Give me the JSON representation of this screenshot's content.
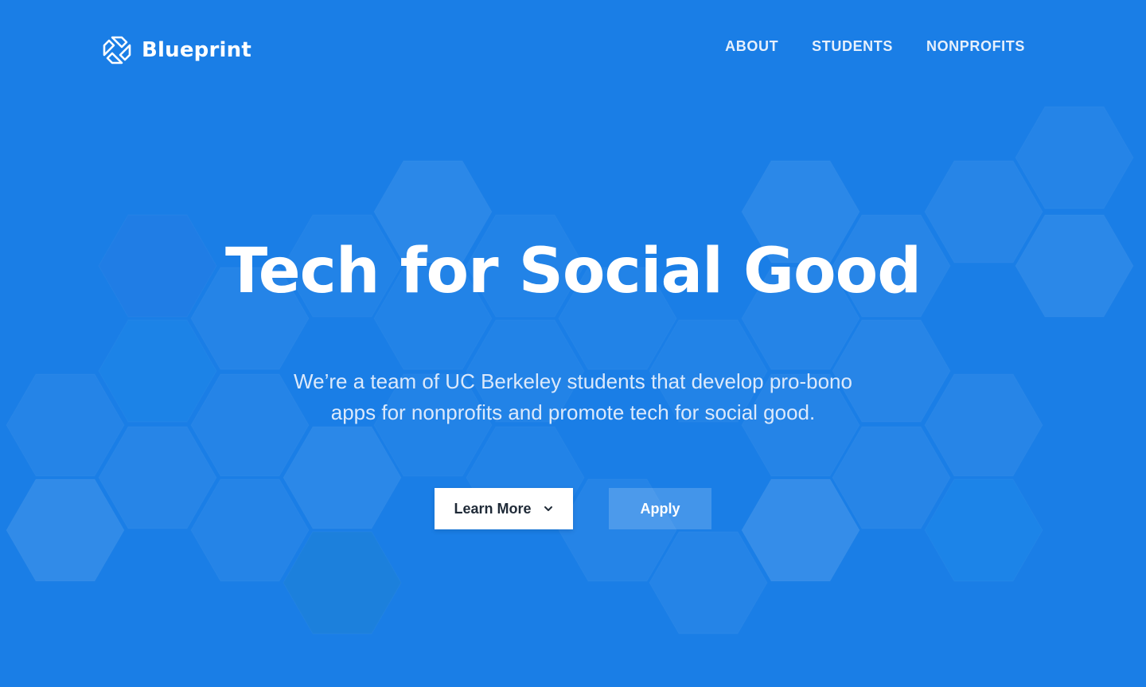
{
  "header": {
    "brand": "Blueprint",
    "nav": [
      {
        "label": "ABOUT"
      },
      {
        "label": "STUDENTS"
      },
      {
        "label": "NONPROFITS"
      }
    ]
  },
  "hero": {
    "title": "Tech for Social Good",
    "subtitle": "We’re a team of UC Berkeley students that develop pro-bono apps for nonprofits and promote tech for social good.",
    "buttons": {
      "learn_more": "Learn More",
      "apply": "Apply"
    }
  },
  "icons": {
    "logo": "blueprint-logo-icon",
    "learn_more": "chevron-down-icon"
  },
  "colors": {
    "background": "#1a7ee6",
    "text": "#ffffff",
    "button_dark_text": "#1f2a37"
  }
}
